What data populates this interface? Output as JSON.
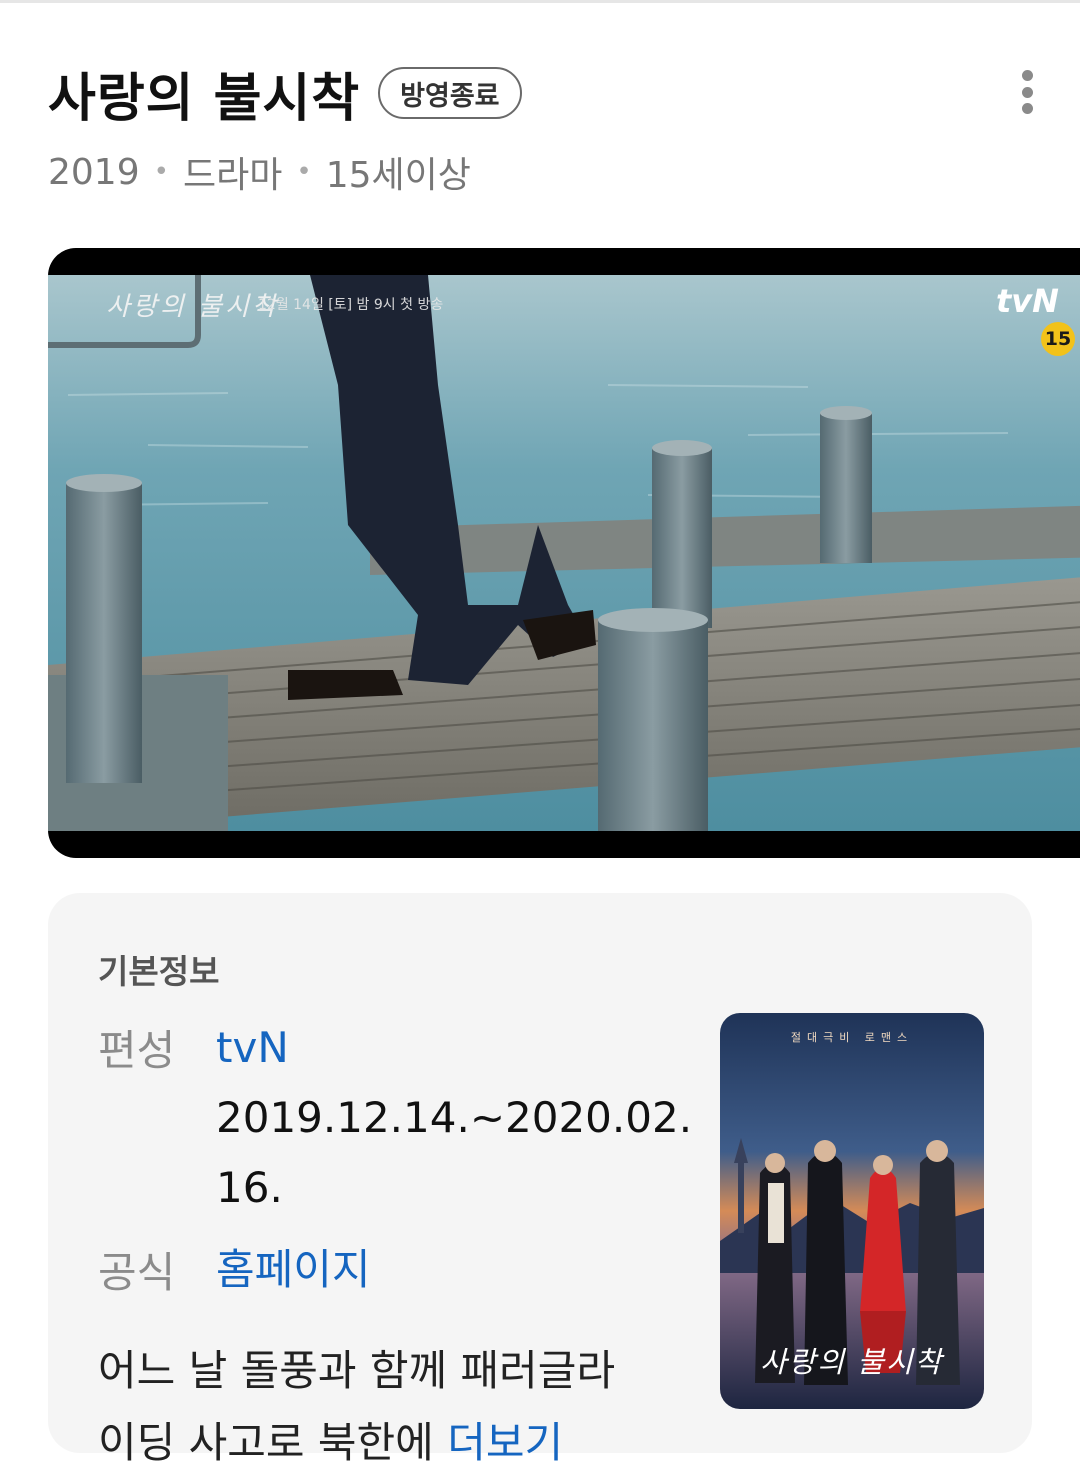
{
  "header": {
    "title": "사랑의 불시착",
    "badge": "방영종료",
    "meta": [
      "2019",
      "드라마",
      "15세이상"
    ]
  },
  "video": {
    "caption": "사랑의 불시착",
    "airing": "12월 14일 [토] 밤 9시 첫 방송",
    "channel_logo": "tvN",
    "rating": "15"
  },
  "info": {
    "section_title": "기본정보",
    "broadcast_label": "편성",
    "broadcast_channel": "tvN",
    "broadcast_period_line1": "2019.12.14.~2020.02.",
    "broadcast_period_line2": "16.",
    "official_label": "공식",
    "official_link": "홈페이지",
    "description_line1": "어느 날 돌풍과 함께 패러글라",
    "description_line2_start": "이딩 사고로 북한에",
    "description_more": "더보기"
  },
  "poster": {
    "title": "사랑의 불시착",
    "tagline": "절대극비 로맨스"
  }
}
